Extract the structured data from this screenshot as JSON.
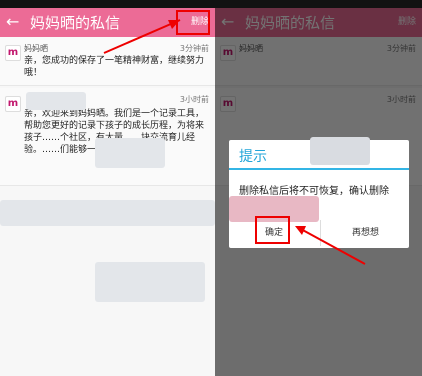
{
  "app": {
    "title": "妈妈晒的私信",
    "back_icon": "←",
    "delete_label": "删除"
  },
  "messages": [
    {
      "sender": "妈妈晒",
      "time": "3分钟前",
      "text": "亲，您成功的保存了一笔精神财富，继续努力哦！"
    },
    {
      "sender": "",
      "time": "3小时前",
      "text": "亲，欢迎来到妈妈晒。我们是一个记录工具，帮助您更好的记录下孩子的成长历程，为将来孩子……个社区，有大量……块交流育儿经验。……们能够一路同行。"
    }
  ],
  "dialog": {
    "title": "提示",
    "body": "删除私信后将不可恢复，确认删除",
    "ok_label": "确定",
    "cancel_label": "再想想"
  },
  "colors": {
    "accent_pink": "#ec6b96",
    "dialog_accent": "#33b5e5",
    "highlight_red": "#e00000"
  }
}
